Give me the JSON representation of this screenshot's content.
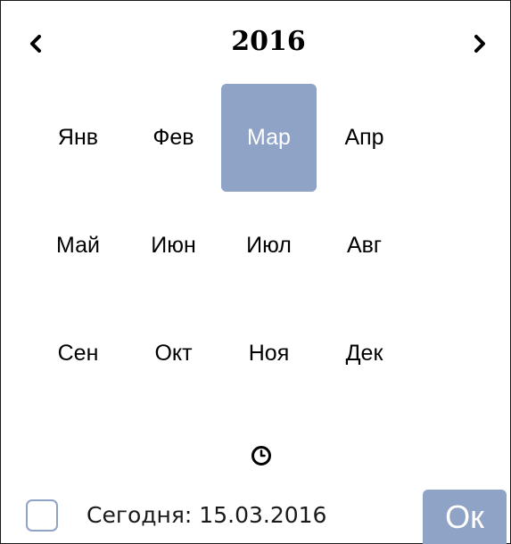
{
  "header": {
    "year": "2016",
    "prev_icon": "chevron-left-icon",
    "next_icon": "chevron-right-icon"
  },
  "months": [
    {
      "label": "Янв"
    },
    {
      "label": "Фев"
    },
    {
      "label": "Мар",
      "selected": true
    },
    {
      "label": "Апр"
    },
    {
      "label": "Май"
    },
    {
      "label": "Июн"
    },
    {
      "label": "Июл"
    },
    {
      "label": "Авг"
    },
    {
      "label": "Сен"
    },
    {
      "label": "Окт"
    },
    {
      "label": "Ноя"
    },
    {
      "label": "Дек"
    }
  ],
  "time_toggle": {
    "icon": "clock-icon"
  },
  "footer": {
    "today_checked": false,
    "today_label": "Сегодня: 15.03.2016",
    "ok_label": "Ок"
  },
  "colors": {
    "accent": "#8fa3c7",
    "text": "#000000",
    "border": "#1a1a1a"
  }
}
